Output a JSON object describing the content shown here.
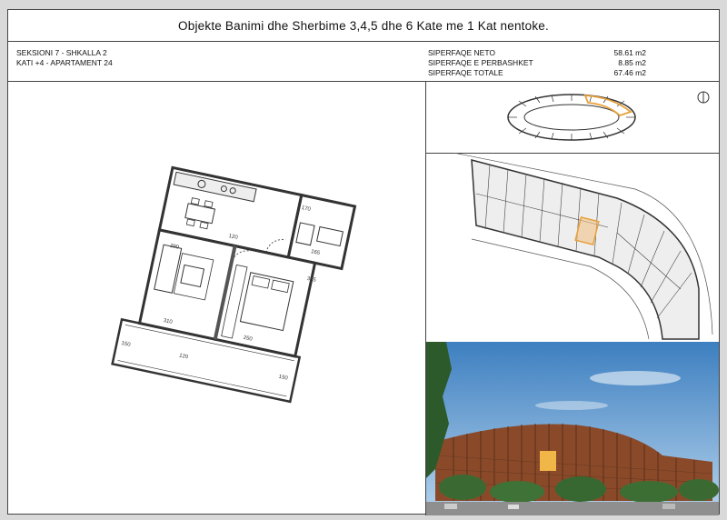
{
  "header": {
    "title": "Objekte Banimi dhe Sherbime 3,4,5 dhe 6 Kate me 1 Kat nentoke."
  },
  "unit_info": {
    "section": "SEKSIONI 7 - SHKALLA 2",
    "floor_apartment": "KATI +4 - APARTAMENT 24"
  },
  "areas": [
    {
      "label": "SIPERFAQE NETO",
      "value": "58.61 m2"
    },
    {
      "label": "SIPERFAQE E PERBASHKET",
      "value": "8.85 m2"
    },
    {
      "label": "SIPERFAQE TOTALE",
      "value": "67.46 m2"
    }
  ],
  "plan_dimensions": [
    "120",
    "315",
    "290",
    "165",
    "170",
    "250",
    "310",
    "120",
    "150",
    "150"
  ],
  "colors": {
    "highlight": "#e8a13a",
    "sky": "#6ea8d6",
    "facade": "#8a4a2a"
  }
}
